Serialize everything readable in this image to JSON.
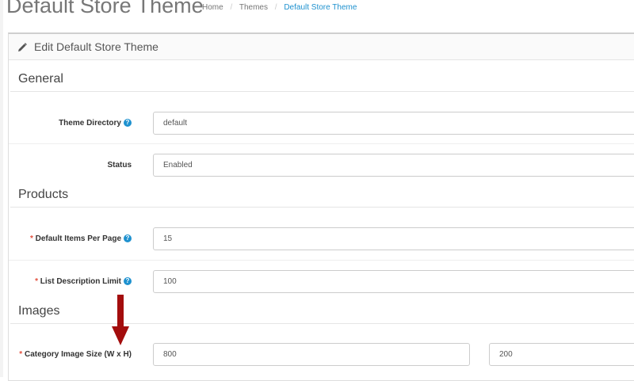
{
  "page": {
    "title": "Default Store Theme",
    "breadcrumbs": [
      "Home",
      "Themes",
      "Default Store Theme"
    ],
    "separator": "/"
  },
  "panel": {
    "heading": "Edit Default Store Theme",
    "heading_icon": "pencil-icon"
  },
  "sections": {
    "general": {
      "title": "General",
      "theme_directory": {
        "label": "Theme Directory",
        "value": "default"
      },
      "status": {
        "label": "Status",
        "value": "Enabled"
      }
    },
    "products": {
      "title": "Products",
      "items_per_page": {
        "required": "*",
        "label": "Default Items Per Page",
        "value": "15"
      },
      "description_limit": {
        "required": "*",
        "label": "List Description Limit",
        "value": "100"
      }
    },
    "images": {
      "title": "Images",
      "category_image_size": {
        "required": "*",
        "label": "Category Image Size (W x H)",
        "width": "800",
        "height": "200"
      }
    }
  },
  "icons": {
    "help": "?",
    "help_icon": "question-circle-icon",
    "annotation": "red-down-arrow"
  },
  "colors": {
    "accent": "#1e91cf",
    "required": "#e3503e",
    "annotation_arrow": "#a30d0d"
  }
}
